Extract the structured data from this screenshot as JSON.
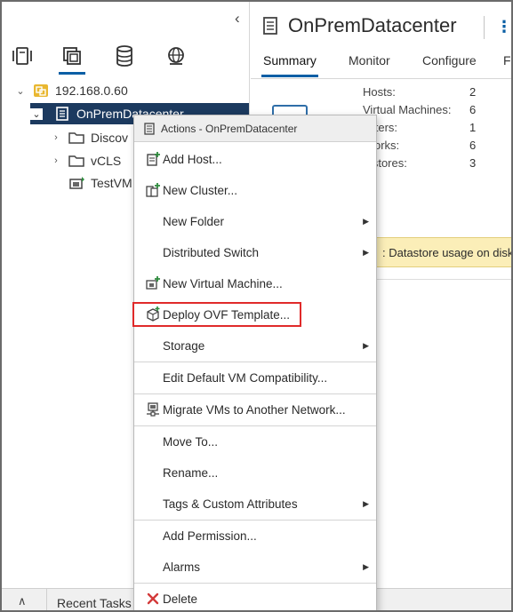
{
  "navigator": {
    "tree": {
      "vcenter": "192.168.0.60",
      "datacenter": "OnPremDatacenter",
      "children": [
        "Discov",
        "vCLS",
        "TestVM"
      ]
    }
  },
  "object": {
    "title": "OnPremDatacenter",
    "tabs": [
      "Summary",
      "Monitor",
      "Configure",
      "F"
    ]
  },
  "summary": {
    "stats": [
      {
        "label": "Hosts:",
        "value": "2"
      },
      {
        "label": "Virtual Machines:",
        "value": "6"
      },
      {
        "label": "usters:",
        "value": "1"
      },
      {
        "label": "tworks:",
        "value": "6"
      },
      {
        "label": "tastores:",
        "value": "3"
      }
    ],
    "alert": ": Datastore usage on disk"
  },
  "bottom": {
    "recent_tasks": "Recent Tasks"
  },
  "menu": {
    "header": "Actions - OnPremDatacenter",
    "items": [
      {
        "label": "Add Host...",
        "icon": "add-host-icon",
        "submenu": false
      },
      {
        "label": "New Cluster...",
        "icon": "new-cluster-icon",
        "submenu": false
      },
      {
        "label": "New Folder",
        "icon": "",
        "submenu": true
      },
      {
        "label": "Distributed Switch",
        "icon": "",
        "submenu": true
      },
      {
        "label": "New Virtual Machine...",
        "icon": "new-vm-icon",
        "submenu": false
      },
      {
        "label": "Deploy OVF Template...",
        "icon": "deploy-ovf-icon",
        "submenu": false
      },
      {
        "label": "Storage",
        "icon": "",
        "submenu": true
      },
      {
        "label": "Edit Default VM Compatibility...",
        "icon": "",
        "submenu": false
      },
      {
        "label": "Migrate VMs to Another Network...",
        "icon": "migrate-icon",
        "submenu": false
      },
      {
        "label": "Move To...",
        "icon": "",
        "submenu": false
      },
      {
        "label": "Rename...",
        "icon": "",
        "submenu": false
      },
      {
        "label": "Tags & Custom Attributes",
        "icon": "",
        "submenu": true
      },
      {
        "label": "Add Permission...",
        "icon": "",
        "submenu": false
      },
      {
        "label": "Alarms",
        "icon": "",
        "submenu": true
      },
      {
        "label": "Delete",
        "icon": "delete-icon",
        "submenu": false
      }
    ]
  },
  "colors": {
    "accent": "#0b5fa5",
    "selected_row": "#1c3a5f",
    "highlight_box": "#e02a2a",
    "alert_bg": "#fbeeb8"
  }
}
